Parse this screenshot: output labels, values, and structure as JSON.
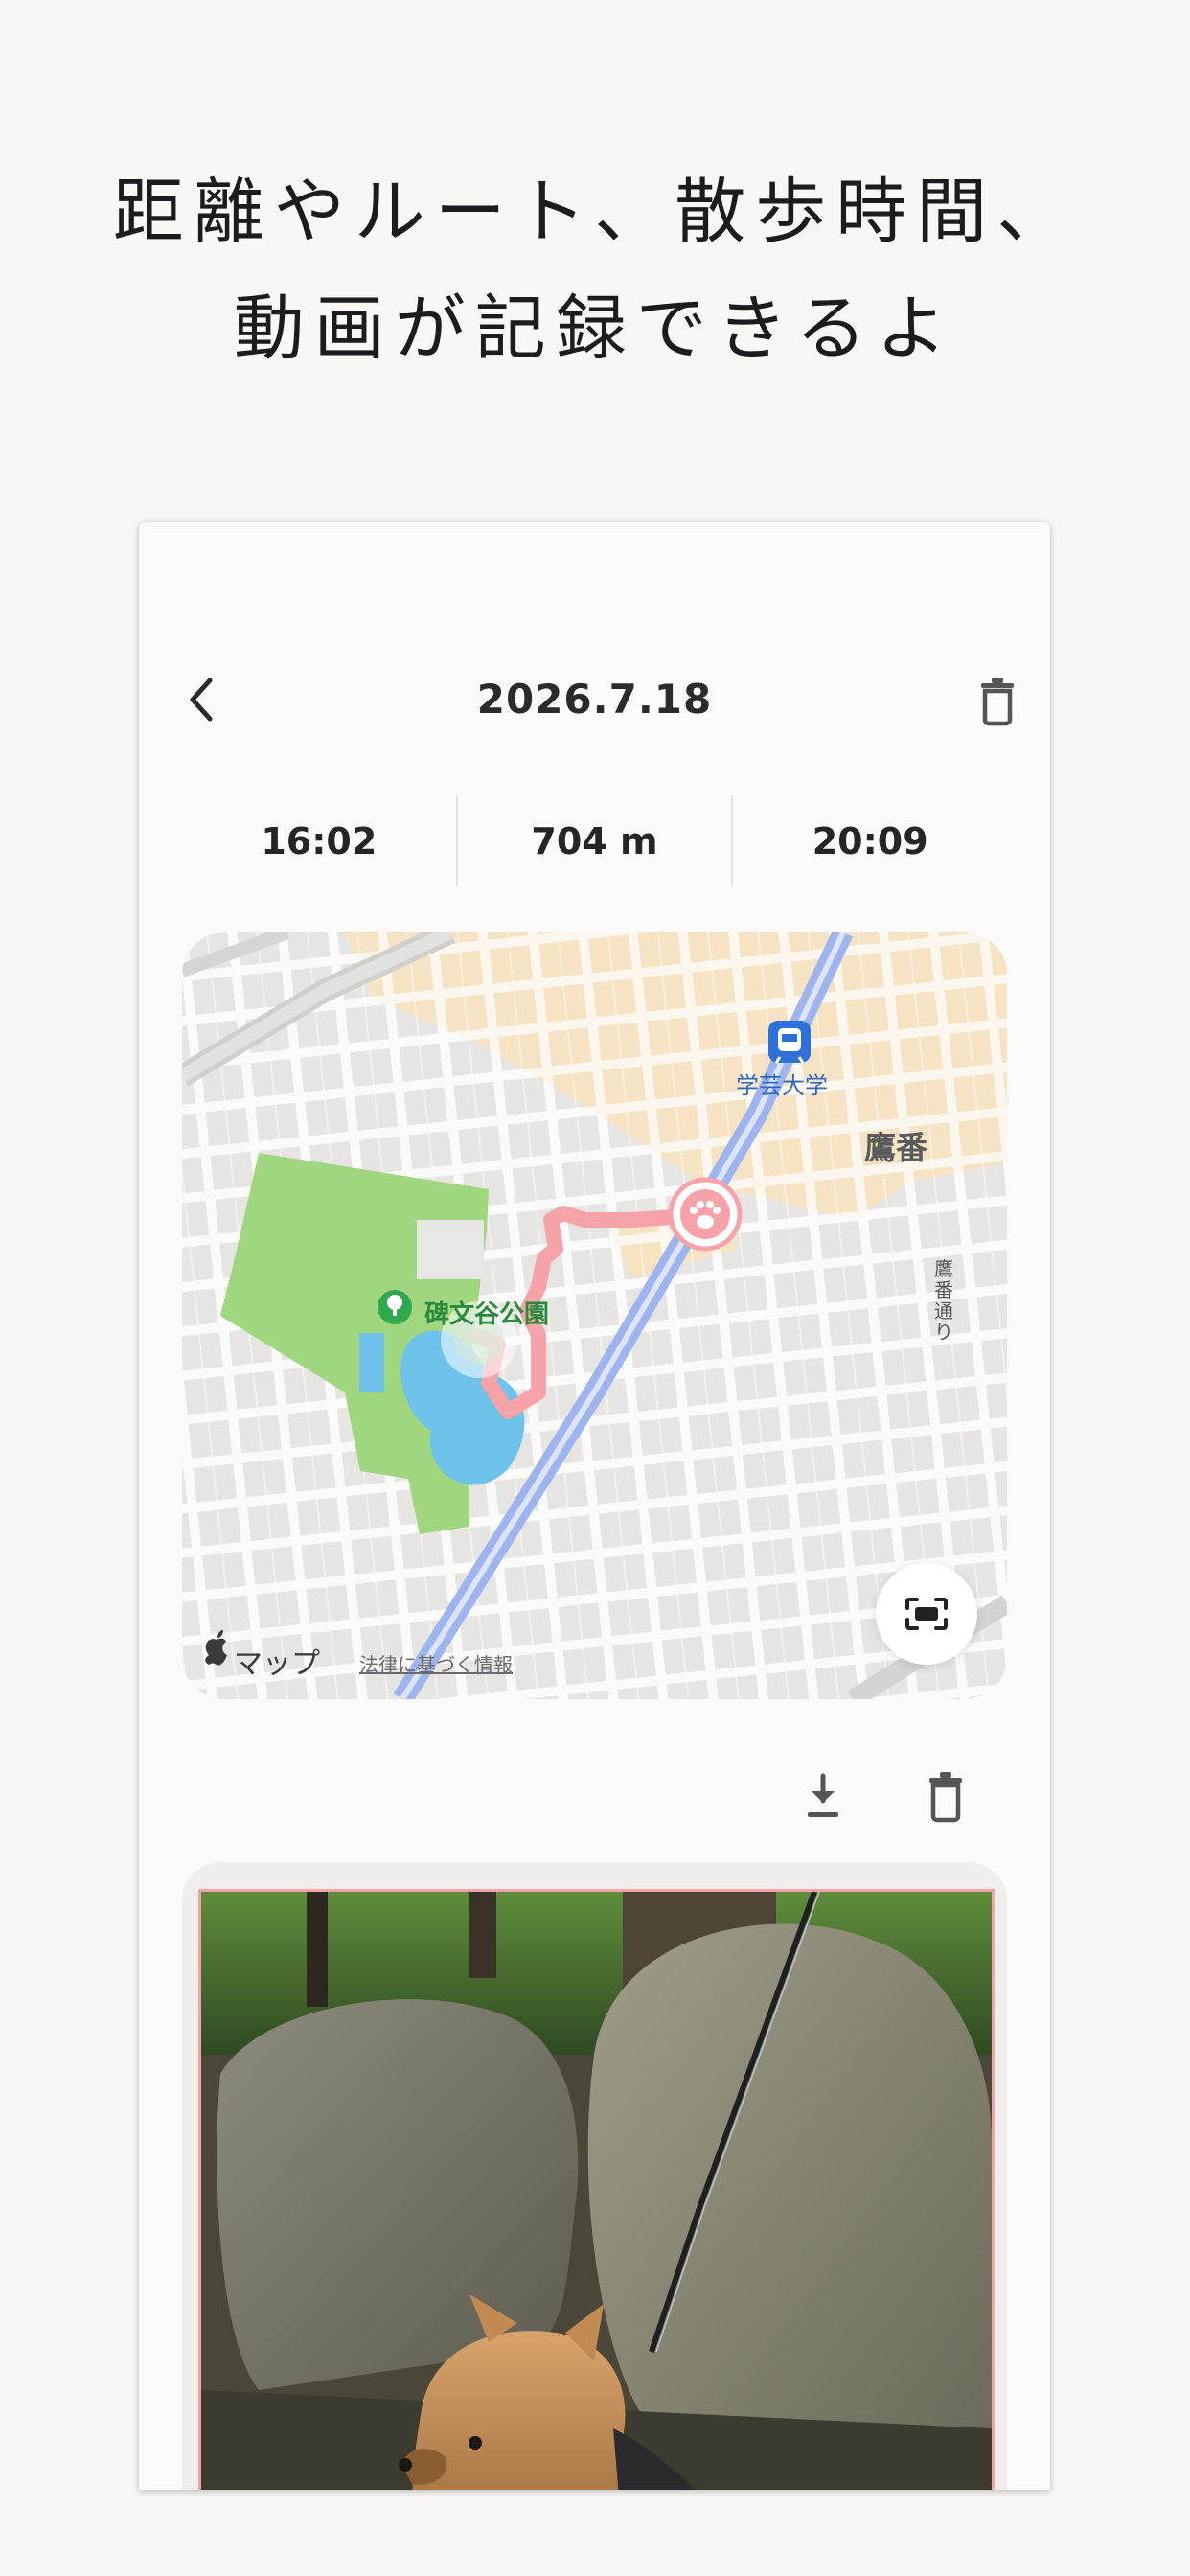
{
  "headline": {
    "line1": "距離やルート、散歩時間、",
    "line2": "動画が記録できるよ"
  },
  "nav": {
    "title": "2026.7.18",
    "back_icon": "chevron-left-icon",
    "delete_icon": "trash-icon"
  },
  "stats": {
    "start_time": "16:02",
    "distance": "704 m",
    "duration": "20:09"
  },
  "map": {
    "station_label": "学芸大学",
    "area_label": "鷹番",
    "park_label": "碑文谷公園",
    "road_label": "鷹番通り",
    "brand": "マップ",
    "legal_link": "法律に基づく情報",
    "route_color": "#f5a3a8",
    "park_color": "#9fd67e",
    "water_color": "#6ec3ea",
    "rail_color": "#9eb4ee"
  },
  "video": {
    "download_icon": "download-icon",
    "delete_icon": "trash-icon",
    "border_color": "#f4a3a7"
  }
}
